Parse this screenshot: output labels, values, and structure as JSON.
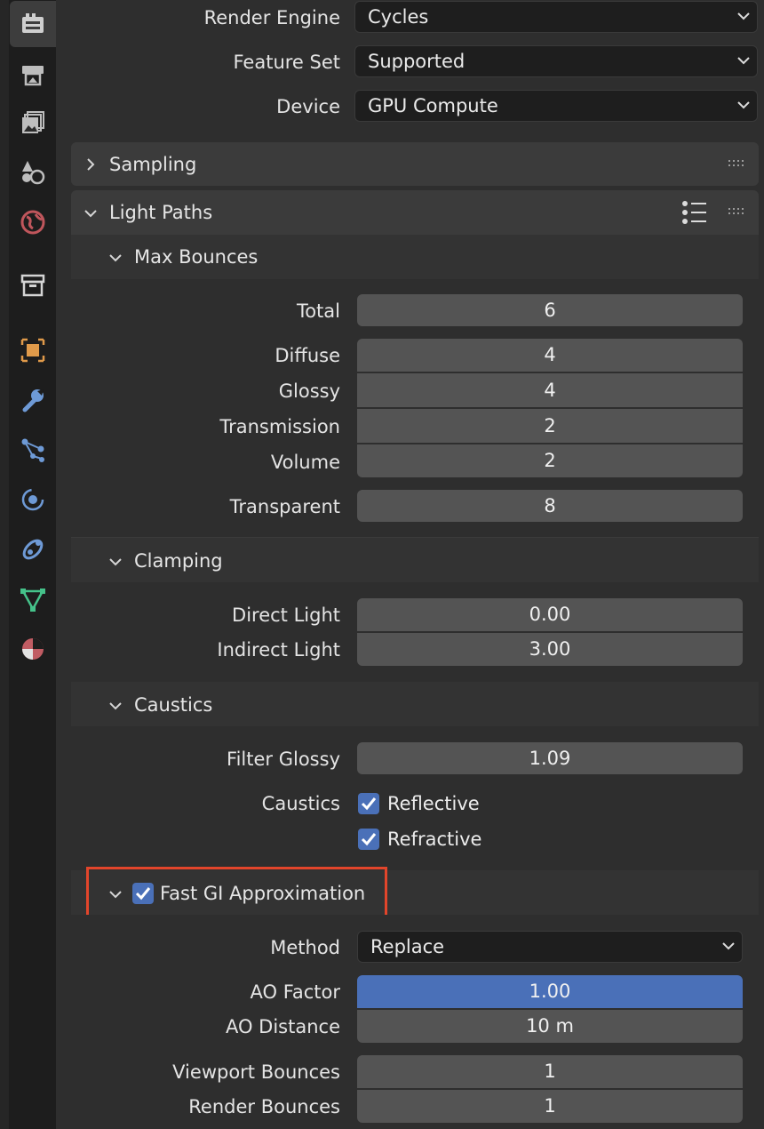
{
  "properties_tabs": [
    {
      "name": "render-tab-icon",
      "active": true
    },
    {
      "name": "output-tab-icon"
    },
    {
      "name": "view-layer-tab-icon"
    },
    {
      "name": "scene-tab-icon"
    },
    {
      "name": "world-tab-icon"
    },
    {
      "name": "collection-tab-icon"
    },
    {
      "name": "object-tab-icon"
    },
    {
      "name": "modifier-wrench-icon"
    },
    {
      "name": "particles-tab-icon"
    },
    {
      "name": "physics-tab-icon"
    },
    {
      "name": "object-constraint-icon"
    },
    {
      "name": "object-data-mesh-icon"
    },
    {
      "name": "material-tab-icon"
    }
  ],
  "render": {
    "engine_label": "Render Engine",
    "engine_value": "Cycles",
    "feature_set_label": "Feature Set",
    "feature_set_value": "Supported",
    "device_label": "Device",
    "device_value": "GPU Compute"
  },
  "sampling": {
    "title": "Sampling"
  },
  "light_paths": {
    "title": "Light Paths",
    "max_bounces": {
      "title": "Max Bounces",
      "total_label": "Total",
      "total_value": "6",
      "diffuse_label": "Diffuse",
      "diffuse_value": "4",
      "glossy_label": "Glossy",
      "glossy_value": "4",
      "transmission_label": "Transmission",
      "transmission_value": "2",
      "volume_label": "Volume",
      "volume_value": "2",
      "transparent_label": "Transparent",
      "transparent_value": "8"
    },
    "clamping": {
      "title": "Clamping",
      "direct_label": "Direct Light",
      "direct_value": "0.00",
      "indirect_label": "Indirect Light",
      "indirect_value": "3.00"
    },
    "caustics": {
      "title": "Caustics",
      "filter_glossy_label": "Filter Glossy",
      "filter_glossy_value": "1.09",
      "caustics_label": "Caustics",
      "reflective_label": "Reflective",
      "reflective_checked": true,
      "refractive_label": "Refractive",
      "refractive_checked": true
    },
    "fast_gi": {
      "title": "Fast GI Approximation",
      "enabled": true,
      "method_label": "Method",
      "method_value": "Replace",
      "ao_factor_label": "AO Factor",
      "ao_factor_value": "1.00",
      "ao_distance_label": "AO Distance",
      "ao_distance_value": "10 m",
      "viewport_bounces_label": "Viewport Bounces",
      "viewport_bounces_value": "1",
      "render_bounces_label": "Render Bounces",
      "render_bounces_value": "1"
    }
  },
  "colors": {
    "accent_blue": "#4a70b8",
    "highlight_box": "#e2452b",
    "field_bg": "#545454",
    "panel_bg": "#3b3b3b"
  }
}
